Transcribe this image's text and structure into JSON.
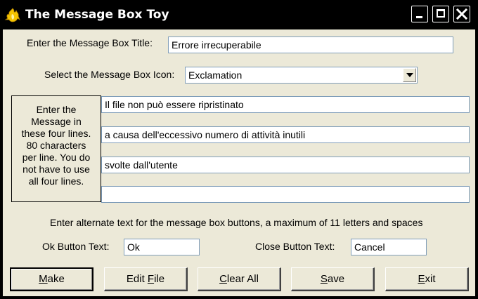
{
  "window": {
    "title": "The Message Box Toy",
    "icon": "flame-icon"
  },
  "title_field": {
    "label": "Enter the Message Box Title:",
    "value": "Errore irrecuperabile"
  },
  "icon_select": {
    "label": "Select the Message Box Icon:",
    "value": "Exclamation"
  },
  "message": {
    "instructions": [
      "Enter the",
      "Message in",
      "these four lines.",
      "80 characters",
      "per line.  You do",
      "not have to use",
      "all four lines."
    ],
    "lines": [
      "Il file non può essere ripristinato",
      "a causa dell'eccessivo numero  di attività inutili",
      "svolte dall'utente",
      ""
    ]
  },
  "button_text": {
    "hint": "Enter alternate text for the message box buttons,  a maximum of 11 letters and spaces",
    "ok_label": "Ok Button Text:",
    "ok_value": "Ok",
    "close_label": "Close Button Text:",
    "close_value": "Cancel"
  },
  "buttons": {
    "make": {
      "pre": "",
      "mnemonic": "M",
      "post": "ake"
    },
    "edit": {
      "pre": "Edit ",
      "mnemonic": "F",
      "post": "ile"
    },
    "clear": {
      "pre": "",
      "mnemonic": "C",
      "post": "lear All"
    },
    "save": {
      "pre": "",
      "mnemonic": "S",
      "post": "ave"
    },
    "exit": {
      "pre": "",
      "mnemonic": "E",
      "post": "xit"
    }
  }
}
